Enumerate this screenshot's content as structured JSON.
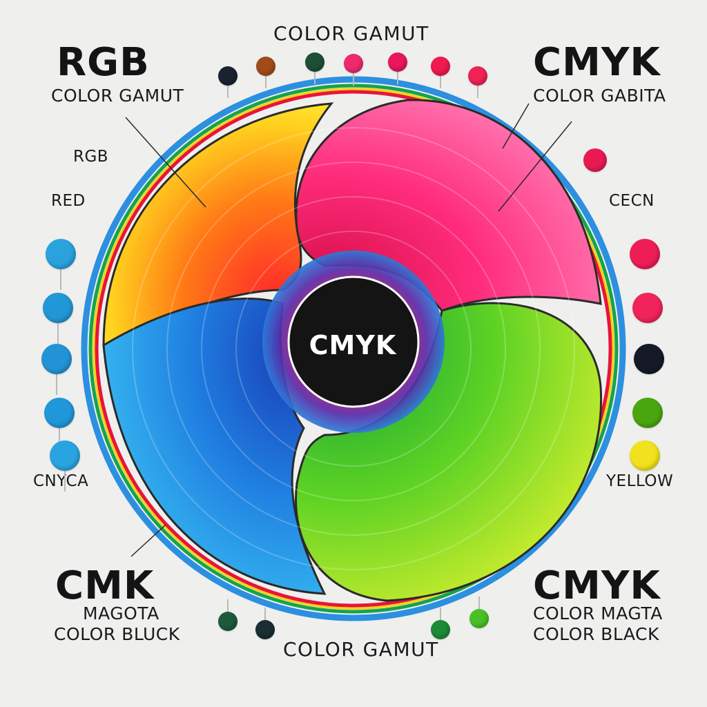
{
  "top_title": "COLOR GAMUT",
  "bottom_title": "COLOR GAMUT",
  "top_left": {
    "heading": "RGB",
    "subheading": "COLOR GAMUT"
  },
  "top_right": {
    "heading": "CMYK",
    "subheading": "COLOR GABITA"
  },
  "bottom_left": {
    "heading": "CMK",
    "line1": "MAGOTA",
    "line2": "COLOR BLUCK"
  },
  "bottom_right": {
    "heading": "CMYK",
    "line1": "COLOR MAGTA",
    "line2": "COLOR BLACK"
  },
  "left_labels": {
    "rgb": "RGB",
    "red": "RED",
    "cyan": "CNYCA"
  },
  "right_labels": {
    "cyan": "CECN",
    "yellow": "YELLOW"
  },
  "center_label": "CMYK",
  "colors": {
    "background": "#efefee",
    "red": "#ff1f3d",
    "magenta": "#ff1b79",
    "yellow": "#ffe51a",
    "cyan": "#1ea6e6",
    "blue": "#1f56d8",
    "green": "#4fd12a",
    "black": "#141414"
  },
  "swatches": {
    "top": [
      "#1b2330",
      "#a24a1a",
      "#1d4f34",
      "#ee2a6c",
      "#e9175a",
      "#ef1a4f",
      "#ee2356"
    ],
    "left": [
      "#2aa2de",
      "#2297d7",
      "#2393d6",
      "#1f97d9",
      "#2aa4e0"
    ],
    "right": [
      "#e91a53",
      "#ee1d56",
      "#f0245a",
      "#161a26",
      "#4aa60f",
      "#f2e21d"
    ],
    "bottom": [
      "#1e5a3a",
      "#1a2e33",
      "#1d8a36",
      "#4ac025"
    ]
  }
}
